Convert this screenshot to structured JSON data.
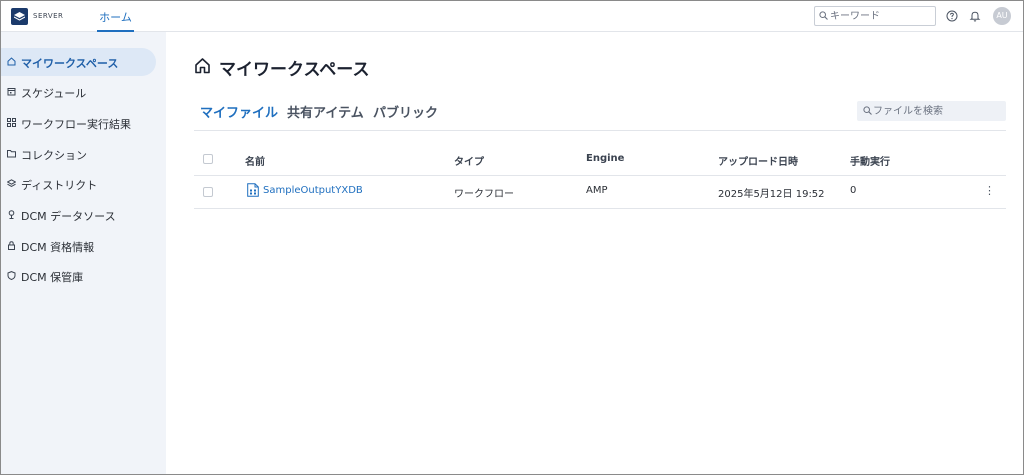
{
  "header": {
    "brand": "SERVER",
    "home_tab": "ホーム",
    "search_placeholder": "キーワード",
    "avatar_initials": "AU"
  },
  "sidebar": {
    "items": [
      {
        "label": "マイワークスペース",
        "icon": "home-icon",
        "active": true
      },
      {
        "label": "スケジュール",
        "icon": "calendar-icon"
      },
      {
        "label": "ワークフロー実行結果",
        "icon": "workflow-icon"
      },
      {
        "label": "コレクション",
        "icon": "folder-icon"
      },
      {
        "label": "ディストリクト",
        "icon": "layers-icon"
      },
      {
        "label": "DCM データソース",
        "icon": "datasource-icon"
      },
      {
        "label": "DCM 資格情報",
        "icon": "lock-icon"
      },
      {
        "label": "DCM 保管庫",
        "icon": "shield-icon"
      }
    ]
  },
  "main": {
    "title": "マイワークスペース",
    "tabs": [
      {
        "label": "マイファイル",
        "active": true
      },
      {
        "label": "共有アイテム"
      },
      {
        "label": "パブリック"
      }
    ],
    "file_search_placeholder": "ファイルを検索",
    "table": {
      "headers": [
        "名前",
        "タイプ",
        "Engine",
        "アップロード日時",
        "手動実行"
      ],
      "rows": [
        {
          "name": "SampleOutputYXDB",
          "type": "ワークフロー",
          "engine": "AMP",
          "uploaded": "2025年5月12日 19:52",
          "manual_runs": "0"
        }
      ]
    }
  },
  "colors": {
    "accent": "#1f6fbf",
    "sidebar_bg": "#f1f4f9",
    "active_nav_bg": "#dde8f6",
    "logo_bg": "#1b3a6b"
  }
}
